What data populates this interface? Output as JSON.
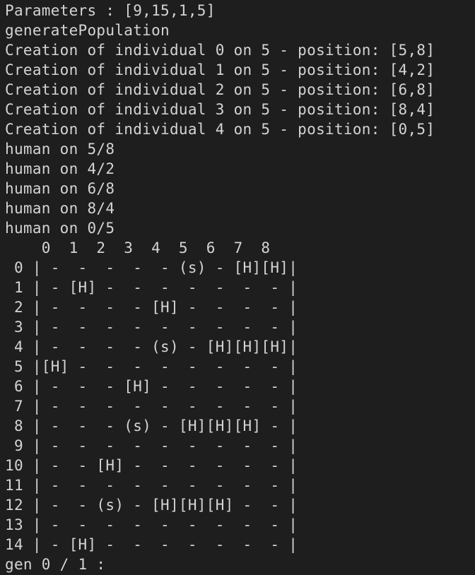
{
  "terminal": {
    "lines": [
      "Parameters : [9,15,1,5]",
      "generatePopulation",
      "Creation of individual 0 on 5 - position: [5,8]",
      "Creation of individual 1 on 5 - position: [4,2]",
      "Creation of individual 2 on 5 - position: [6,8]",
      "Creation of individual 3 on 5 - position: [8,4]",
      "Creation of individual 4 on 5 - position: [0,5]",
      "human on 5/8",
      "human on 4/2",
      "human on 6/8",
      "human on 8/4",
      "human on 0/5",
      "    0  1  2  3  4  5  6  7  8",
      " 0 | -  -  -  -  - (s) - [H][H]|",
      " 1 | - [H] -  -  -  -  -  -  - |",
      " 2 | -  -  -  - [H] -  -  -  - |",
      " 3 | -  -  -  -  -  -  -  -  - |",
      " 4 | -  -  -  - (s) - [H][H][H]|",
      " 5 |[H] -  -  -  -  -  -  -  - |",
      " 6 | -  -  - [H] -  -  -  -  - |",
      " 7 | -  -  -  -  -  -  -  -  - |",
      " 8 | -  -  - (s) - [H][H][H] - |",
      " 9 | -  -  -  -  -  -  -  -  - |",
      "10 | -  - [H] -  -  -  -  -  - |",
      "11 | -  -  -  -  -  -  -  -  - |",
      "12 | -  - (s) - [H][H][H] -  - |",
      "13 | -  -  -  -  -  -  -  -  - |",
      "14 | - [H] -  -  -  -  -  -  - |",
      "gen 0 / 1 :"
    ]
  },
  "colors": {
    "background": "#1e1e1e",
    "text": "#d4d4d4"
  }
}
